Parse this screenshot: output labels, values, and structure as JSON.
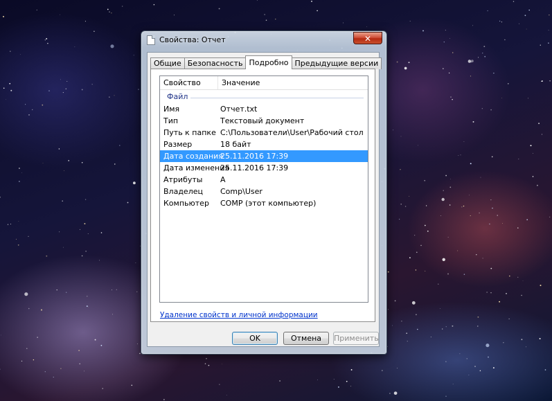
{
  "window": {
    "title": "Свойства: Отчет",
    "close_glyph": "✕"
  },
  "tabs": [
    {
      "label": "Общие",
      "active": false
    },
    {
      "label": "Безопасность",
      "active": false
    },
    {
      "label": "Подробно",
      "active": true
    },
    {
      "label": "Предыдущие версии",
      "active": false
    }
  ],
  "details": {
    "columns": [
      "Свойство",
      "Значение"
    ],
    "group": "Файл",
    "rows": [
      {
        "key": "Имя",
        "value": "Отчет.txt",
        "selected": false
      },
      {
        "key": "Тип",
        "value": "Текстовый документ",
        "selected": false
      },
      {
        "key": "Путь к папке",
        "value": "C:\\Пользователи\\User\\Рабочий стол",
        "selected": false
      },
      {
        "key": "Размер",
        "value": "18 байт",
        "selected": false
      },
      {
        "key": "Дата создания",
        "value": "25.11.2016 17:39",
        "selected": true
      },
      {
        "key": "Дата изменения",
        "value": "25.11.2016 17:39",
        "selected": false
      },
      {
        "key": "Атрибуты",
        "value": "A",
        "selected": false
      },
      {
        "key": "Владелец",
        "value": "Comp\\User",
        "selected": false
      },
      {
        "key": "Компьютер",
        "value": "COMP (этот компьютер)",
        "selected": false
      }
    ],
    "remove_link": "Удаление свойств и личной информации"
  },
  "buttons": {
    "ok": "OK",
    "cancel": "Отмена",
    "apply": "Применить"
  },
  "colors": {
    "selection": "#3399ff",
    "link": "#0033cc",
    "group_header": "#1e3287"
  },
  "icons": {
    "title": "text-file-icon",
    "close": "close-icon"
  }
}
